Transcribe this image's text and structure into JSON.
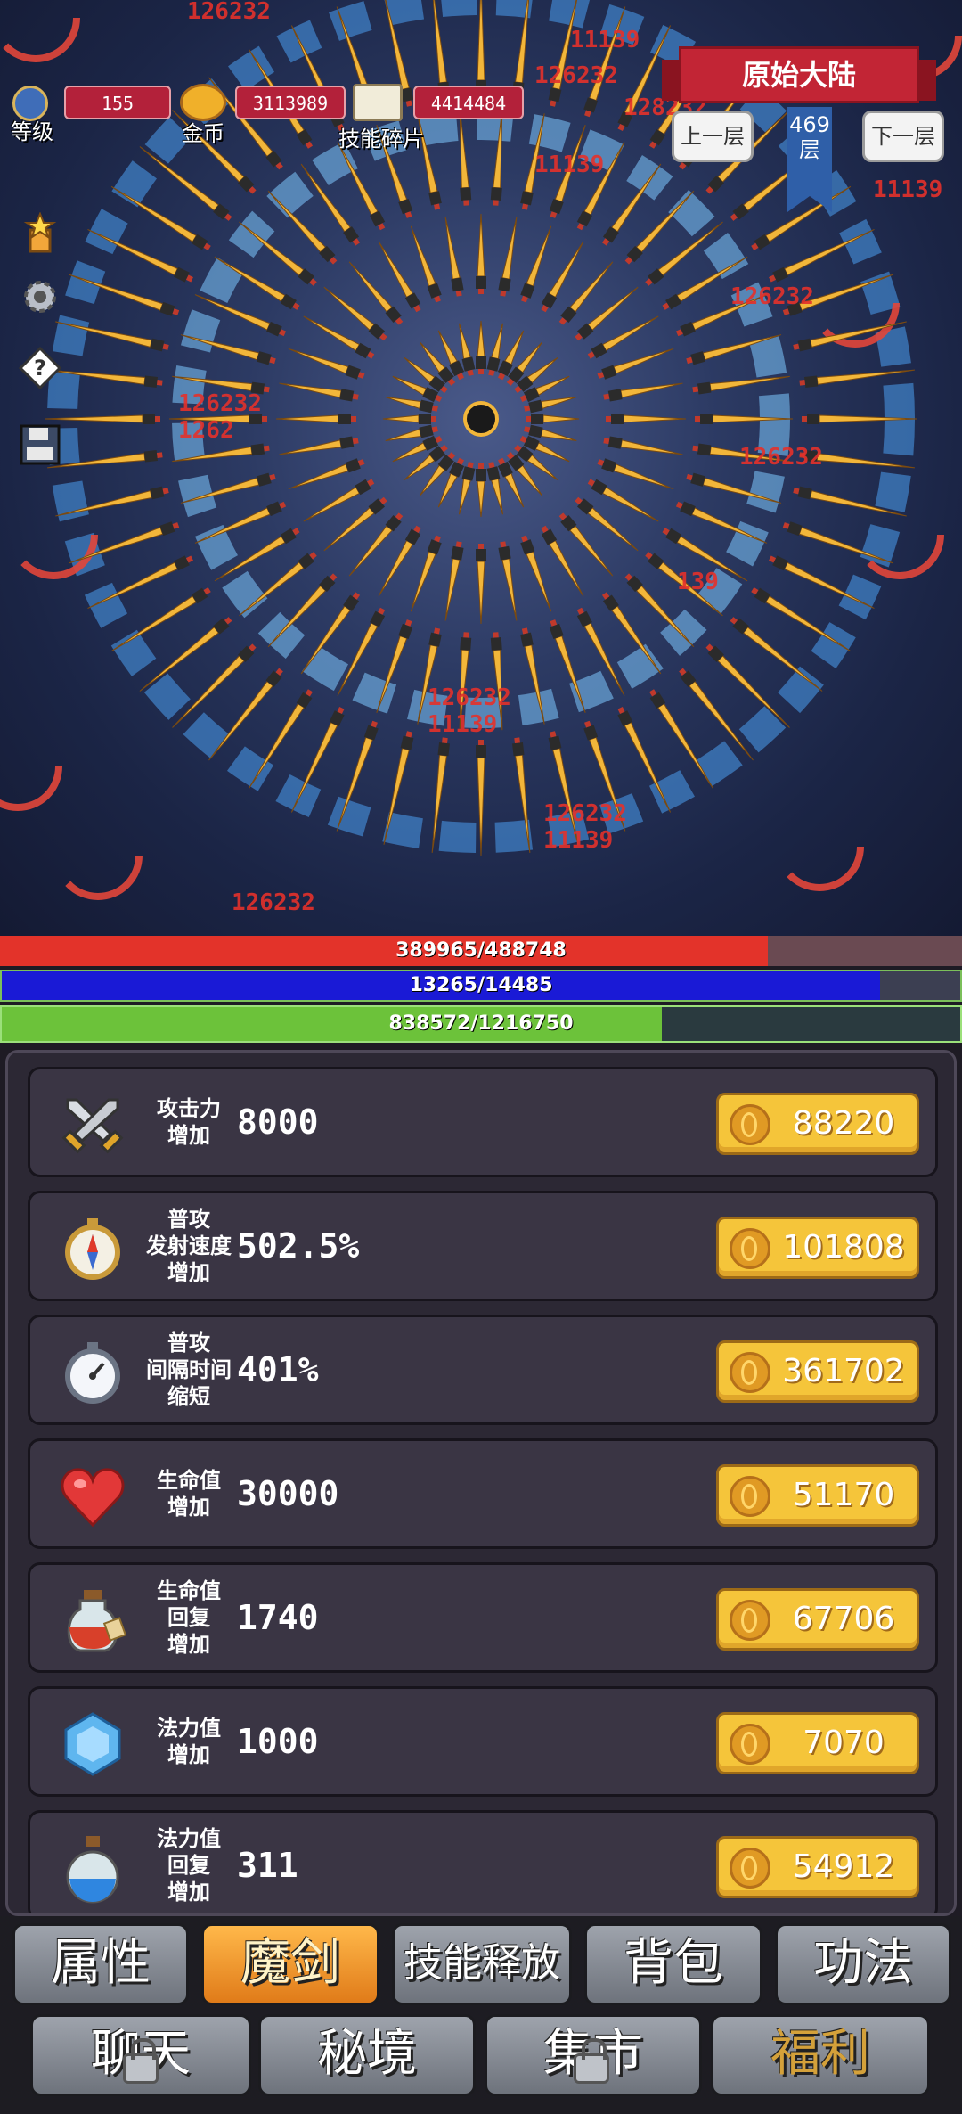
{
  "hud": {
    "level_label": "等级",
    "level_value": "155",
    "gold_label": "金币",
    "gold_value": "3113989",
    "fragments_label": "技能碎片",
    "fragments_value": "4414484"
  },
  "region": {
    "title": "原始大陆",
    "prev_floor": "上一层",
    "next_floor": "下一层",
    "floor_number": "469",
    "floor_unit": "层"
  },
  "damage_numbers": [
    "126232",
    "11139",
    "126232",
    "128232",
    "126232",
    "1262",
    "126232",
    "11139",
    "126232",
    "139",
    "126232",
    "11139",
    "126232",
    "11139",
    "126232",
    "11139"
  ],
  "bars": {
    "hp_text": "389965/488748",
    "hp_fraction": 0.798,
    "hp_color": "#e3332a",
    "mp_text": "13265/14485",
    "mp_fraction": 0.916,
    "mp_color": "#1a1ad6",
    "exp_text": "838572/1216750",
    "exp_fraction": 0.689,
    "exp_color": "#6cc23a"
  },
  "upgrades": [
    {
      "icon": "crossed-swords-icon",
      "name": "攻击力\n增加",
      "value": "8000",
      "cost": "88220"
    },
    {
      "icon": "compass-icon",
      "name": "普攻\n发射速度\n增加",
      "value": "502.5%",
      "cost": "101808"
    },
    {
      "icon": "stopwatch-icon",
      "name": "普攻\n间隔时间\n缩短",
      "value": "401%",
      "cost": "361702"
    },
    {
      "icon": "heart-icon",
      "name": "生命值\n增加",
      "value": "30000",
      "cost": "51170"
    },
    {
      "icon": "health-potion-icon",
      "name": "生命值\n回复\n增加",
      "value": "1740",
      "cost": "67706"
    },
    {
      "icon": "mana-crystal-icon",
      "name": "法力值\n增加",
      "value": "1000",
      "cost": "7070"
    },
    {
      "icon": "mana-potion-icon",
      "name": "法力值\n回复\n增加",
      "value": "311",
      "cost": "54912"
    }
  ],
  "nav": {
    "row1": [
      "属性",
      "魔剑",
      "技能释放",
      "背包",
      "功法"
    ],
    "row2": [
      "聊天",
      "秘境",
      "集市",
      "福利"
    ]
  }
}
